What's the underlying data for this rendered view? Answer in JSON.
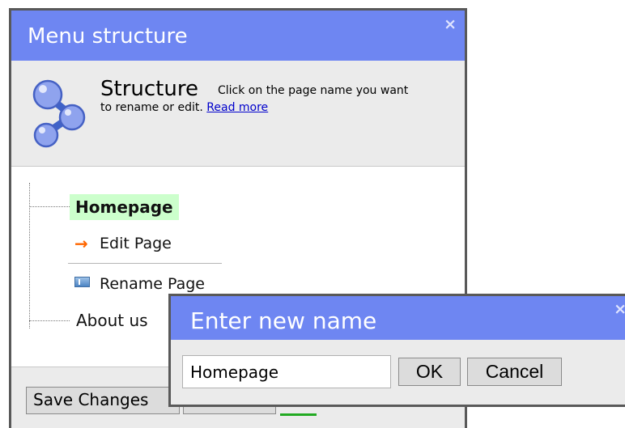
{
  "dialog": {
    "title": "Menu structure",
    "close_glyph": "×",
    "header": {
      "icon": "structure-icon",
      "title": "Structure",
      "description_line1": "Click on the page name you want",
      "description_line2": "to rename or edit.",
      "read_more": "Read more"
    },
    "tree": {
      "selected_page": "Homepage",
      "actions": [
        {
          "icon": "arrow-right-icon",
          "label": "Edit Page"
        },
        {
          "icon": "rename-icon",
          "label": "Rename Page"
        }
      ],
      "other_pages": [
        "About us"
      ]
    },
    "footer": {
      "save_label": "Save Changes"
    }
  },
  "rename_popup": {
    "title": "Enter new name",
    "close_glyph": "×",
    "input_value": "Homepage",
    "ok_label": "OK",
    "cancel_label": "Cancel"
  },
  "colors": {
    "title_bar": "#6e86f2",
    "selected_highlight": "#ccffcc",
    "link": "#0000cc",
    "arrow": "#ff6600"
  }
}
